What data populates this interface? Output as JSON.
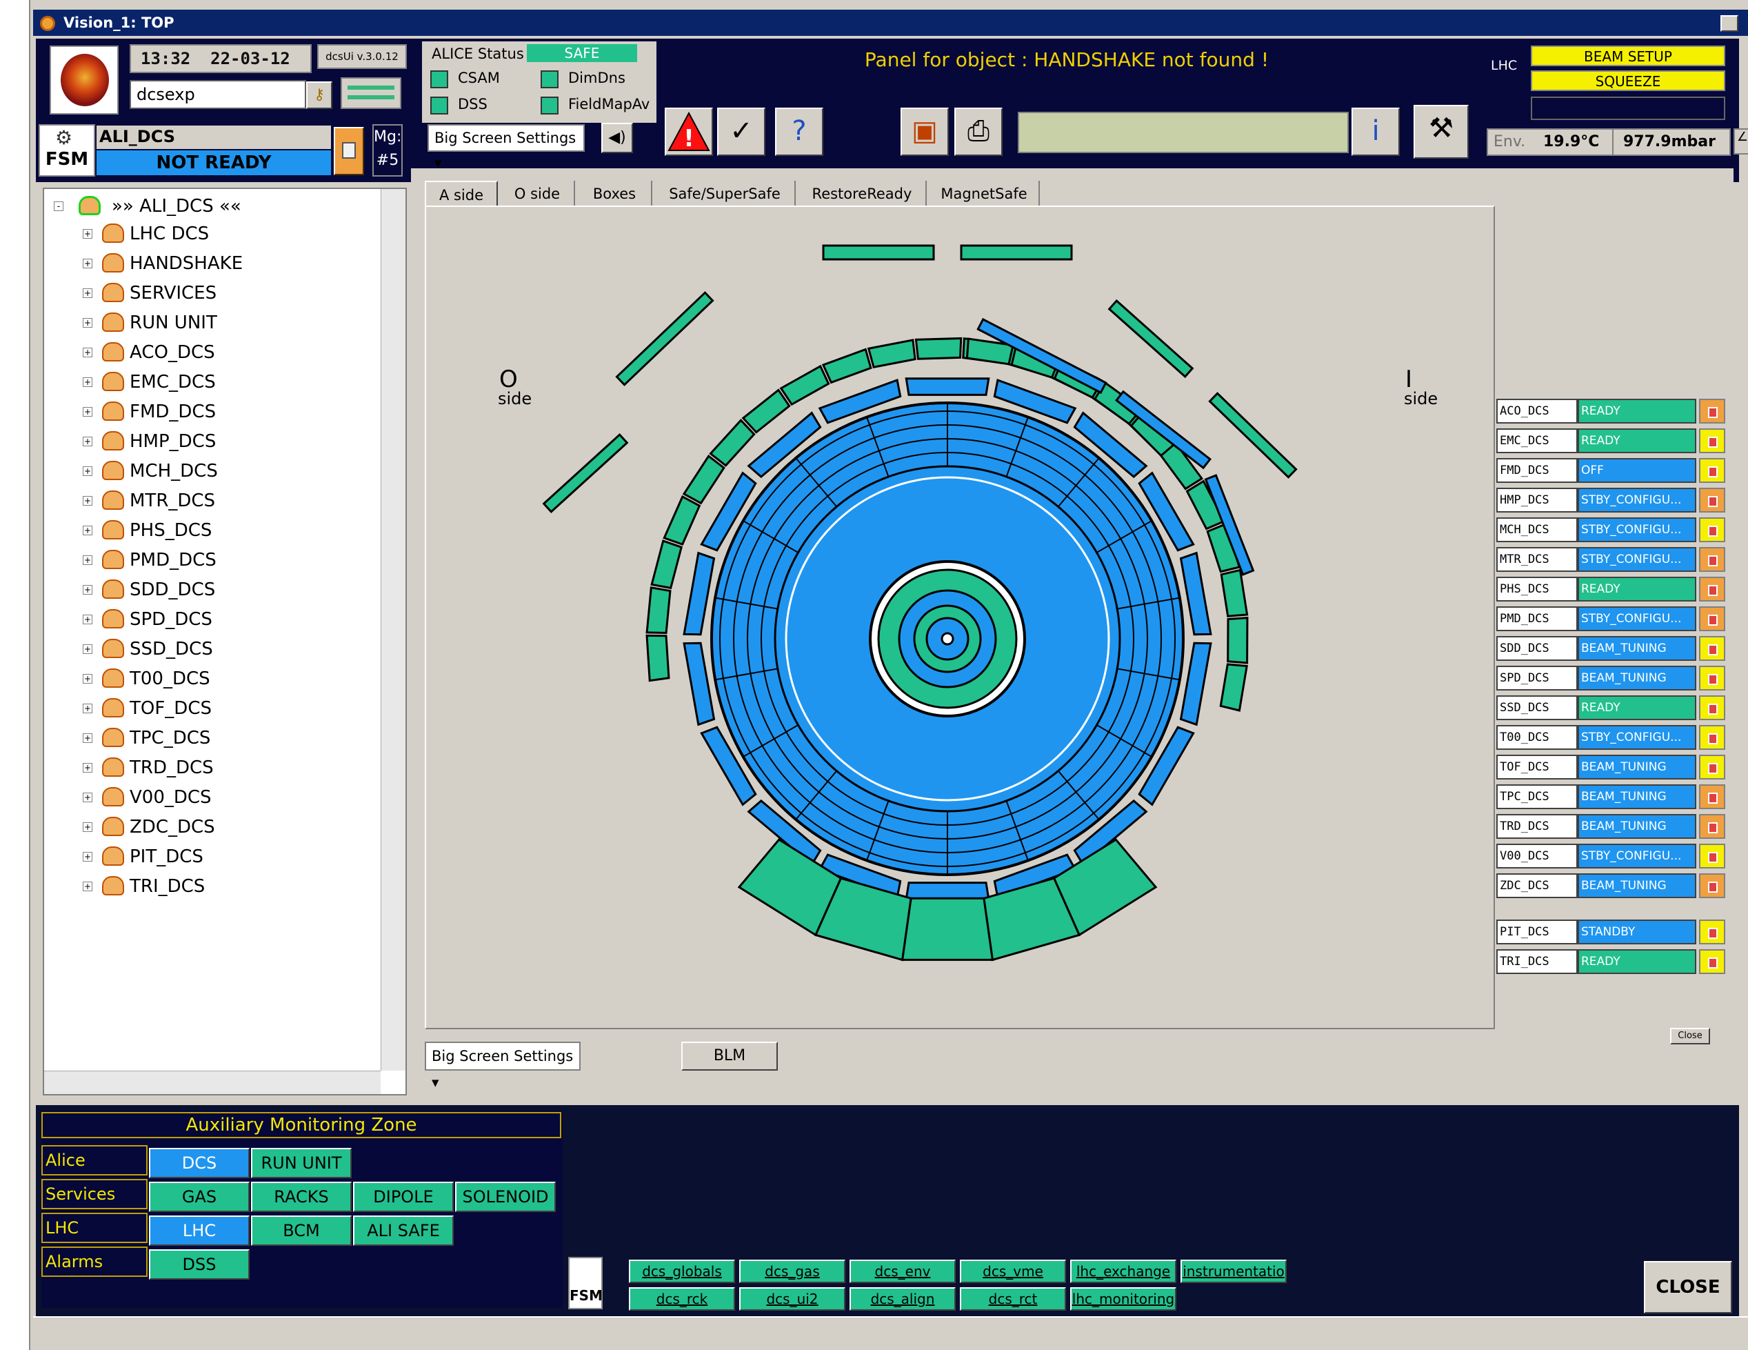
{
  "window": {
    "title": "Vision_1: TOP"
  },
  "header": {
    "time": "13:32",
    "date": "22-03-12",
    "version": "dcsUi v.3.0.12",
    "username": "dcsexp",
    "fsm_label": "FSM",
    "node_name": "ALI_DCS",
    "node_state": "NOT READY",
    "mg_label": "Mg:",
    "mg_value": "#5"
  },
  "alice_status": {
    "label": "ALICE Status",
    "value": "SAFE",
    "items": [
      "CSAM",
      "DimDns",
      "DSS",
      "FieldMapAv"
    ]
  },
  "message": "Panel for object : HANDSHAKE not found !",
  "lhc": {
    "label": "LHC",
    "beam_mode": "BEAM SETUP",
    "machine_mode": "SQUEEZE"
  },
  "env": {
    "label": "Env.",
    "temperature": "19.9°C",
    "pressure": "977.9mbar"
  },
  "big_screen_settings": "Big Screen Settings",
  "tree": {
    "root": "»» ALI_DCS ««",
    "items": [
      "LHC DCS",
      "HANDSHAKE",
      "SERVICES",
      "RUN UNIT",
      "ACO_DCS",
      "EMC_DCS",
      "FMD_DCS",
      "HMP_DCS",
      "MCH_DCS",
      "MTR_DCS",
      "PHS_DCS",
      "PMD_DCS",
      "SDD_DCS",
      "SPD_DCS",
      "SSD_DCS",
      "T00_DCS",
      "TOF_DCS",
      "TPC_DCS",
      "TRD_DCS",
      "V00_DCS",
      "ZDC_DCS",
      "PIT_DCS",
      "TRI_DCS"
    ]
  },
  "tabs": [
    "A side",
    "O side",
    "Boxes",
    "Safe/SuperSafe",
    "RestoreReady",
    "MagnetSafe"
  ],
  "side_labels": {
    "o_letter": "O",
    "i_letter": "I",
    "side": "side"
  },
  "detectors": [
    {
      "name": "ACO_DCS",
      "state": "READY",
      "color": "#22c08c",
      "lock": "orange"
    },
    {
      "name": "EMC_DCS",
      "state": "READY",
      "color": "#22c08c",
      "lock": "yellow"
    },
    {
      "name": "FMD_DCS",
      "state": "OFF",
      "color": "#1f95f0",
      "lock": "yellow"
    },
    {
      "name": "HMP_DCS",
      "state": "STBY_CONFIGU...",
      "color": "#1f95f0",
      "lock": "orange"
    },
    {
      "name": "MCH_DCS",
      "state": "STBY_CONFIGU...",
      "color": "#1f95f0",
      "lock": "yellow"
    },
    {
      "name": "MTR_DCS",
      "state": "STBY_CONFIGU...",
      "color": "#1f95f0",
      "lock": "orange"
    },
    {
      "name": "PHS_DCS",
      "state": "READY",
      "color": "#22c08c",
      "lock": "orange"
    },
    {
      "name": "PMD_DCS",
      "state": "STBY_CONFIGU...",
      "color": "#1f95f0",
      "lock": "orange"
    },
    {
      "name": "SDD_DCS",
      "state": "BEAM_TUNING",
      "color": "#1f95f0",
      "lock": "yellow"
    },
    {
      "name": "SPD_DCS",
      "state": "BEAM_TUNING",
      "color": "#1f95f0",
      "lock": "yellow"
    },
    {
      "name": "SSD_DCS",
      "state": "READY",
      "color": "#22c08c",
      "lock": "yellow"
    },
    {
      "name": "T00_DCS",
      "state": "STBY_CONFIGU...",
      "color": "#1f95f0",
      "lock": "yellow"
    },
    {
      "name": "TOF_DCS",
      "state": "BEAM_TUNING",
      "color": "#1f95f0",
      "lock": "yellow"
    },
    {
      "name": "TPC_DCS",
      "state": "BEAM_TUNING",
      "color": "#1f95f0",
      "lock": "orange"
    },
    {
      "name": "TRD_DCS",
      "state": "BEAM_TUNING",
      "color": "#1f95f0",
      "lock": "orange"
    },
    {
      "name": "V00_DCS",
      "state": "STBY_CONFIGU...",
      "color": "#1f95f0",
      "lock": "yellow"
    },
    {
      "name": "ZDC_DCS",
      "state": "BEAM_TUNING",
      "color": "#1f95f0",
      "lock": "orange"
    },
    {
      "name": "PIT_DCS",
      "state": "STANDBY",
      "color": "#1f95f0",
      "lock": "yellow"
    },
    {
      "name": "TRI_DCS",
      "state": "READY",
      "color": "#22c08c",
      "lock": "yellow"
    }
  ],
  "close_small": "Close",
  "blm": "BLM",
  "aux": {
    "title": "Auxiliary Monitoring Zone",
    "rows": [
      {
        "label": "Alice",
        "buttons": [
          {
            "t": "DCS",
            "c": "b"
          },
          {
            "t": "RUN UNIT",
            "c": "g"
          }
        ]
      },
      {
        "label": "Services",
        "buttons": [
          {
            "t": "GAS",
            "c": "g"
          },
          {
            "t": "RACKS",
            "c": "g"
          },
          {
            "t": "DIPOLE",
            "c": "g"
          },
          {
            "t": "SOLENOID",
            "c": "g"
          }
        ]
      },
      {
        "label": "LHC",
        "buttons": [
          {
            "t": "LHC",
            "c": "b"
          },
          {
            "t": "BCM",
            "c": "g"
          },
          {
            "t": "ALI SAFE",
            "c": "g"
          }
        ]
      },
      {
        "label": "Alarms",
        "buttons": [
          {
            "t": "DSS",
            "c": "g"
          }
        ]
      }
    ]
  },
  "quick": {
    "row1": [
      "dcs_globals",
      "dcs_gas",
      "dcs_env",
      "dcs_vme",
      "lhc_exchange",
      "instrumentatio"
    ],
    "row2": [
      "dcs_rck",
      "dcs_ui2",
      "dcs_align",
      "dcs_rct",
      "lhc_monitoring"
    ]
  },
  "close_big": "CLOSE",
  "colors": {
    "green": "#22c08c",
    "blue": "#1f95f0",
    "yellow": "#f4f000",
    "navy": "#06083a"
  }
}
